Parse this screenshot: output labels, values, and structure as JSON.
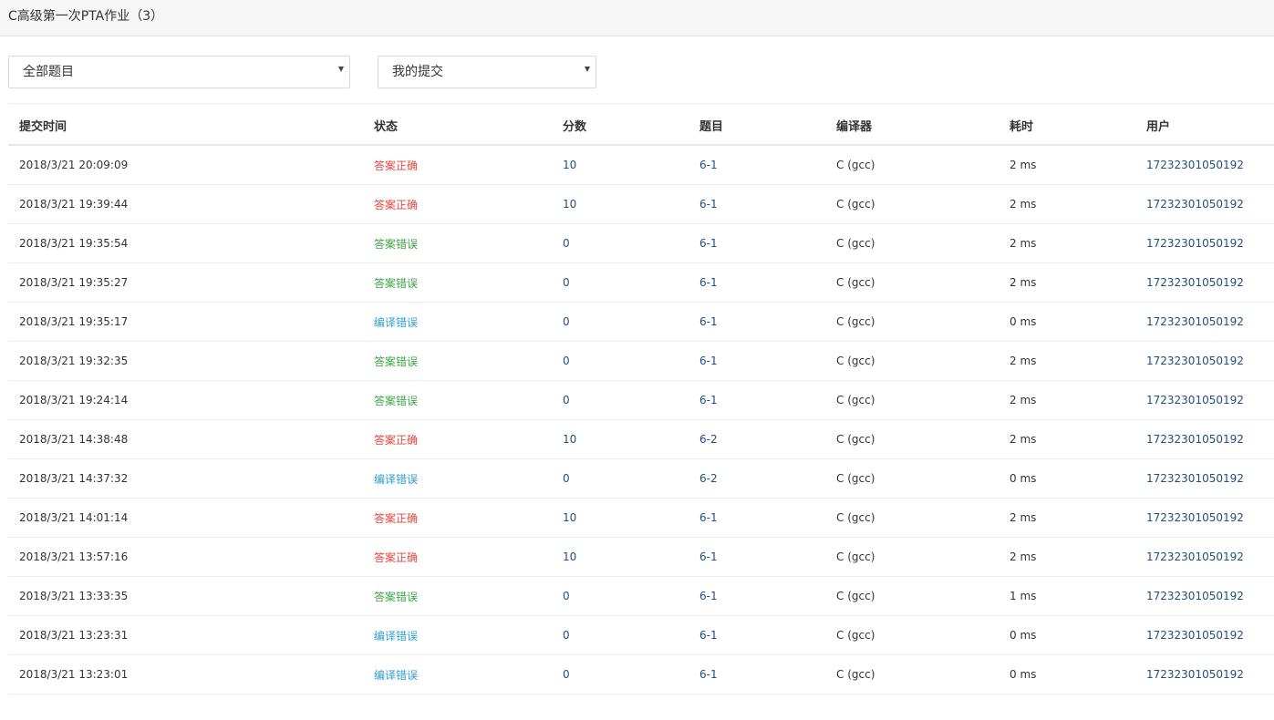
{
  "page": {
    "title": "C高级第一次PTA作业（3）"
  },
  "filters": {
    "problem_filter": "全部题目",
    "scope_filter": "我的提交"
  },
  "table": {
    "headers": {
      "time": "提交时间",
      "status": "状态",
      "score": "分数",
      "problem": "题目",
      "compiler": "编译器",
      "elapsed": "耗时",
      "user": "用户"
    },
    "rows": [
      {
        "time": "2018/3/21 20:09:09",
        "status": "答案正确",
        "status_type": "ok",
        "score": "10",
        "problem": "6-1",
        "compiler": "C (gcc)",
        "elapsed": "2 ms",
        "user": "17232301050192"
      },
      {
        "time": "2018/3/21 19:39:44",
        "status": "答案正确",
        "status_type": "ok",
        "score": "10",
        "problem": "6-1",
        "compiler": "C (gcc)",
        "elapsed": "2 ms",
        "user": "17232301050192"
      },
      {
        "time": "2018/3/21 19:35:54",
        "status": "答案错误",
        "status_type": "wrong",
        "score": "0",
        "problem": "6-1",
        "compiler": "C (gcc)",
        "elapsed": "2 ms",
        "user": "17232301050192"
      },
      {
        "time": "2018/3/21 19:35:27",
        "status": "答案错误",
        "status_type": "wrong",
        "score": "0",
        "problem": "6-1",
        "compiler": "C (gcc)",
        "elapsed": "2 ms",
        "user": "17232301050192"
      },
      {
        "time": "2018/3/21 19:35:17",
        "status": "编译错误",
        "status_type": "ce",
        "score": "0",
        "problem": "6-1",
        "compiler": "C (gcc)",
        "elapsed": "0 ms",
        "user": "17232301050192"
      },
      {
        "time": "2018/3/21 19:32:35",
        "status": "答案错误",
        "status_type": "wrong",
        "score": "0",
        "problem": "6-1",
        "compiler": "C (gcc)",
        "elapsed": "2 ms",
        "user": "17232301050192"
      },
      {
        "time": "2018/3/21 19:24:14",
        "status": "答案错误",
        "status_type": "wrong",
        "score": "0",
        "problem": "6-1",
        "compiler": "C (gcc)",
        "elapsed": "2 ms",
        "user": "17232301050192"
      },
      {
        "time": "2018/3/21 14:38:48",
        "status": "答案正确",
        "status_type": "ok",
        "score": "10",
        "problem": "6-2",
        "compiler": "C (gcc)",
        "elapsed": "2 ms",
        "user": "17232301050192"
      },
      {
        "time": "2018/3/21 14:37:32",
        "status": "编译错误",
        "status_type": "ce",
        "score": "0",
        "problem": "6-2",
        "compiler": "C (gcc)",
        "elapsed": "0 ms",
        "user": "17232301050192"
      },
      {
        "time": "2018/3/21 14:01:14",
        "status": "答案正确",
        "status_type": "ok",
        "score": "10",
        "problem": "6-1",
        "compiler": "C (gcc)",
        "elapsed": "2 ms",
        "user": "17232301050192"
      },
      {
        "time": "2018/3/21 13:57:16",
        "status": "答案正确",
        "status_type": "ok",
        "score": "10",
        "problem": "6-1",
        "compiler": "C (gcc)",
        "elapsed": "2 ms",
        "user": "17232301050192"
      },
      {
        "time": "2018/3/21 13:33:35",
        "status": "答案错误",
        "status_type": "wrong",
        "score": "0",
        "problem": "6-1",
        "compiler": "C (gcc)",
        "elapsed": "1 ms",
        "user": "17232301050192"
      },
      {
        "time": "2018/3/21 13:23:31",
        "status": "编译错误",
        "status_type": "ce",
        "score": "0",
        "problem": "6-1",
        "compiler": "C (gcc)",
        "elapsed": "0 ms",
        "user": "17232301050192"
      },
      {
        "time": "2018/3/21 13:23:01",
        "status": "编译错误",
        "status_type": "ce",
        "score": "0",
        "problem": "6-1",
        "compiler": "C (gcc)",
        "elapsed": "0 ms",
        "user": "17232301050192"
      }
    ]
  },
  "colors": {
    "status_ok": "#e0473f",
    "status_wrong": "#3fa444",
    "status_ce": "#2c9fd6",
    "link": "#1f4f7e"
  },
  "icons": {
    "dropdown": "caret-down-icon"
  }
}
